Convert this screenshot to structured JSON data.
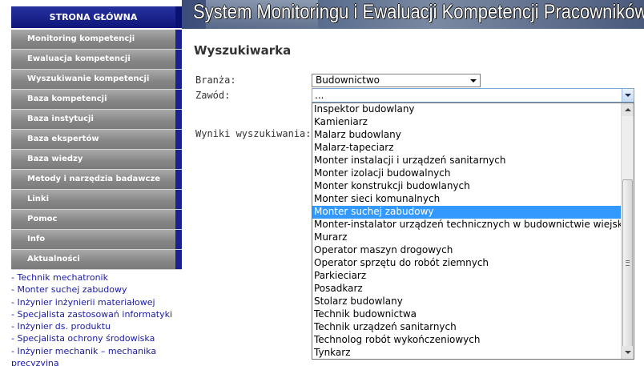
{
  "sidebar": {
    "home_label": "STRONA GŁÓWNA",
    "menu": [
      "Monitoring kompetencji",
      "Ewaluacja kompetencji",
      "Wyszukiwanie kompetencji",
      "Baza kompetencji",
      "Baza instytucji",
      "Baza ekspertów",
      "Baza wiedzy",
      "Metody i narzędzia badawcze",
      "Linki",
      "Pomoc",
      "Info",
      "Aktualności"
    ],
    "news": [
      "- Technik mechatronik",
      "- Monter suchej zabudowy",
      "- Inżynier inżynierii materiałowej",
      "- Specjalista zastosowań informatyki",
      "- Inżynier ds. produktu",
      "- Specjalista ochrony środowiska",
      "- Inżynier mechanik – mechanika precyzyjna"
    ]
  },
  "header": {
    "banner_title": "System Monitoringu i Ewaluacji Kompetencji Pracowników"
  },
  "main": {
    "page_title": "Wyszukiwarka",
    "branza_label": "Branża:",
    "branza_value": "Budownictwo",
    "zawod_label": "Zawód:",
    "zawod_value": "...",
    "results_label": "Wyniki wyszukiwania:",
    "zawod_options": [
      "Inspektor budowlany",
      "Kamieniarz",
      "Malarz budowlany",
      "Malarz-tapeciarz",
      "Monter instalacji i urządzeń sanitarnych",
      "Monter izolacji budowalnych",
      "Monter konstrukcji budowlanych",
      "Monter sieci komunalnych",
      "Monter suchej zabudowy",
      "Monter-instalator urządzeń technicznych w budownictwie wiejskim",
      "Murarz",
      "Operator maszyn drogowych",
      "Operator sprzętu do robót ziemnych",
      "Parkieciarz",
      "Posadkarz",
      "Stolarz budowlany",
      "Technik budownictwa",
      "Technik urządzeń sanitarnych",
      "Technolog robót wykończeniowych",
      "Tynkarz"
    ],
    "highlighted_option": "Monter suchej zabudowy"
  },
  "colors": {
    "sidebar_accent": "#1b2290",
    "menu_gray": "#858585",
    "link_blue": "#1a1aa8",
    "highlight": "#3399ff"
  }
}
